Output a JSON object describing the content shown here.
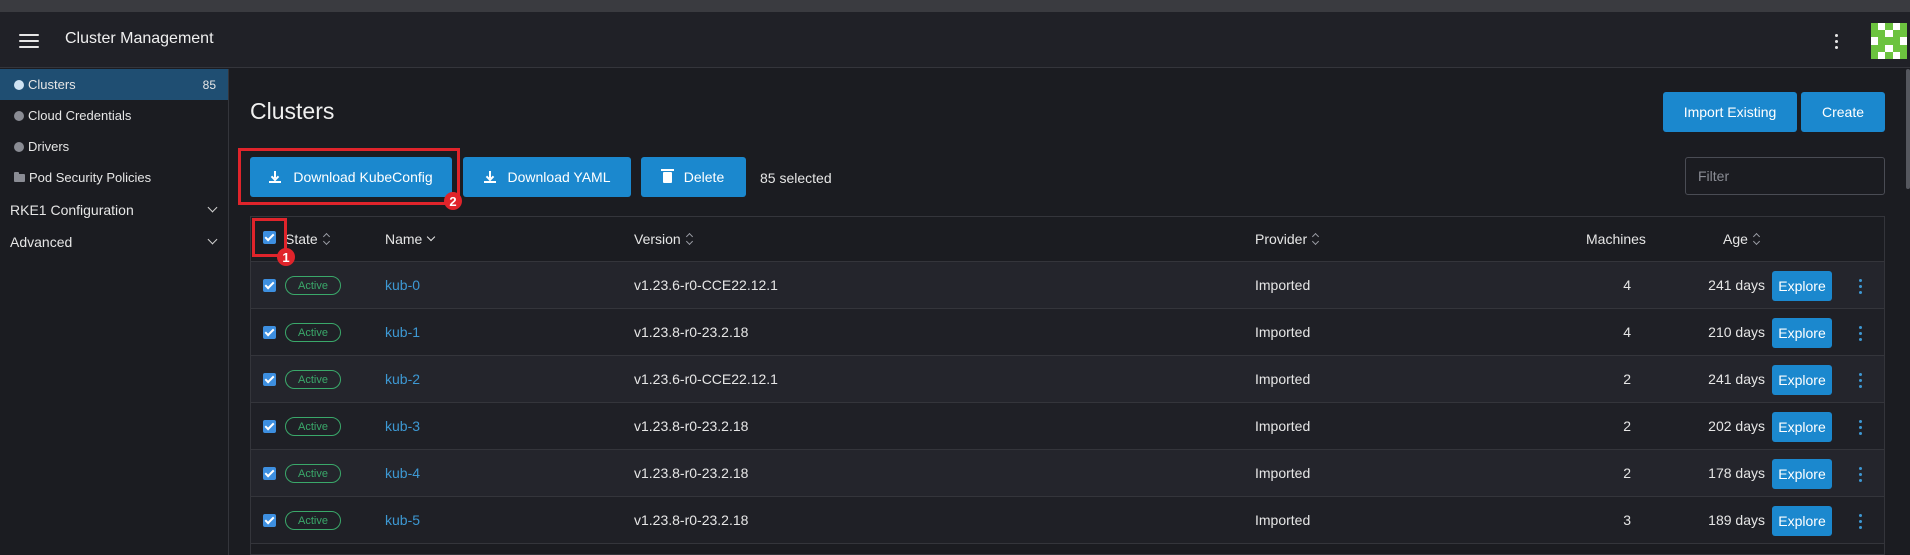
{
  "header": {
    "title": "Cluster Management"
  },
  "sidebar": {
    "items": [
      {
        "label": "Clusters",
        "count": "85"
      },
      {
        "label": "Cloud Credentials"
      },
      {
        "label": "Drivers"
      },
      {
        "label": "Pod Security Policies"
      }
    ],
    "groups": [
      {
        "label": "RKE1 Configuration"
      },
      {
        "label": "Advanced"
      }
    ]
  },
  "main": {
    "title": "Clusters",
    "import_label": "Import Existing",
    "create_label": "Create",
    "download_kubeconfig_label": "Download KubeConfig",
    "download_yaml_label": "Download YAML",
    "delete_label": "Delete",
    "selected_text": "85 selected",
    "filter_placeholder": "Filter"
  },
  "table": {
    "columns": [
      "State",
      "Name",
      "Version",
      "Provider",
      "Machines",
      "Age"
    ],
    "explore_label": "Explore",
    "rows": [
      {
        "state": "Active",
        "name": "kub-0",
        "version": "v1.23.6-r0-CCE22.12.1",
        "provider": "Imported",
        "machines": "4",
        "age": "241 days"
      },
      {
        "state": "Active",
        "name": "kub-1",
        "version": "v1.23.8-r0-23.2.18",
        "provider": "Imported",
        "machines": "4",
        "age": "210 days"
      },
      {
        "state": "Active",
        "name": "kub-2",
        "version": "v1.23.6-r0-CCE22.12.1",
        "provider": "Imported",
        "machines": "2",
        "age": "241 days"
      },
      {
        "state": "Active",
        "name": "kub-3",
        "version": "v1.23.8-r0-23.2.18",
        "provider": "Imported",
        "machines": "2",
        "age": "202 days"
      },
      {
        "state": "Active",
        "name": "kub-4",
        "version": "v1.23.8-r0-23.2.18",
        "provider": "Imported",
        "machines": "2",
        "age": "178 days"
      },
      {
        "state": "Active",
        "name": "kub-5",
        "version": "v1.23.8-r0-23.2.18",
        "provider": "Imported",
        "machines": "3",
        "age": "189 days"
      }
    ]
  },
  "annotations": {
    "first": "1",
    "second": "2"
  },
  "colors": {
    "accent": "#1b88ce",
    "active_badge": "#3aa86a",
    "annotation": "#e0242b",
    "link": "#3d98d3"
  },
  "icons": [
    "menu-icon",
    "kebab-icon",
    "globe-icon",
    "download-icon",
    "trash-icon",
    "sort-icon",
    "chevron-down-icon",
    "folder-icon"
  ]
}
